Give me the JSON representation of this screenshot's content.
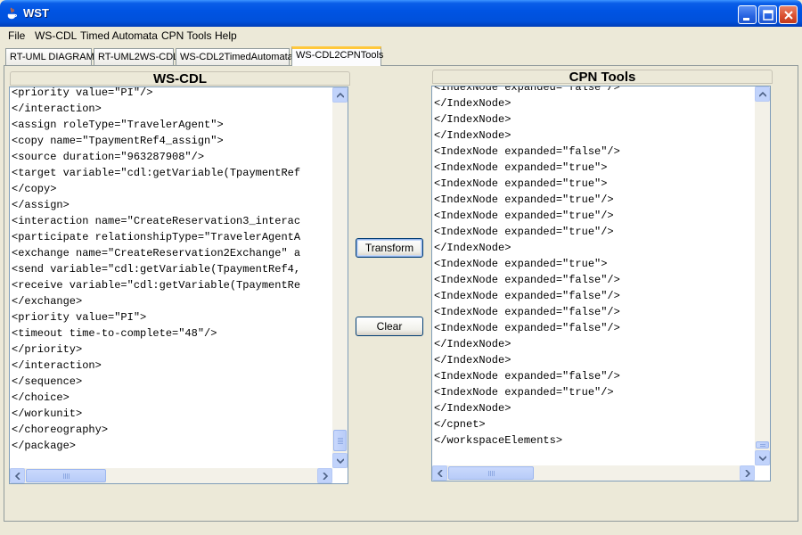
{
  "window": {
    "title": "WST"
  },
  "menu": [
    "File",
    "WS-CDL",
    "Timed Automata",
    "CPN Tools",
    "Help"
  ],
  "tabs": [
    {
      "label": "RT-UML DIAGRAM",
      "active": false
    },
    {
      "label": "RT-UML2WS-CDL",
      "active": false
    },
    {
      "label": "WS-CDL2TimedAutomata",
      "active": false
    },
    {
      "label": "WS-CDL2CPNTools",
      "active": true
    }
  ],
  "left_panel": {
    "title": "WS-CDL",
    "lines": [
      "<priority value=\"PI\"/>",
      "</interaction>",
      "<assign roleType=\"TravelerAgent\">",
      "<copy name=\"TpaymentRef4_assign\">",
      "<source duration=\"963287908\"/>",
      "<target variable=\"cdl:getVariable(TpaymentRef",
      "</copy>",
      "</assign>",
      "<interaction name=\"CreateReservation3_interac",
      "<participate relationshipType=\"TravelerAgentA",
      "<exchange name=\"CreateReservation2Exchange\" a",
      "<send variable=\"cdl:getVariable(TpaymentRef4,",
      "<receive variable=\"cdl:getVariable(TpaymentRe",
      "</exchange>",
      "<priority value=\"PI\">",
      "<timeout time-to-complete=\"48\"/>",
      "</priority>",
      "</interaction>",
      "</sequence>",
      "</choice>",
      "</workunit>",
      "</choreography>",
      "</package>"
    ]
  },
  "right_panel": {
    "title": "CPN Tools",
    "lines": [
      "<IndexNode expanded=\"false\"/>",
      "</IndexNode>",
      "</IndexNode>",
      "</IndexNode>",
      "<IndexNode expanded=\"false\"/>",
      "<IndexNode expanded=\"true\">",
      "<IndexNode expanded=\"true\">",
      "<IndexNode expanded=\"true\"/>",
      "<IndexNode expanded=\"true\"/>",
      "<IndexNode expanded=\"true\"/>",
      "</IndexNode>",
      "<IndexNode expanded=\"true\">",
      "<IndexNode expanded=\"false\"/>",
      "<IndexNode expanded=\"false\"/>",
      "<IndexNode expanded=\"false\"/>",
      "<IndexNode expanded=\"false\"/>",
      "</IndexNode>",
      "</IndexNode>",
      "<IndexNode expanded=\"false\"/>",
      "<IndexNode expanded=\"true\"/>",
      "</IndexNode>",
      "</cpnet>",
      "</workspaceElements>"
    ]
  },
  "buttons": {
    "transform": "Transform",
    "clear": "Clear"
  }
}
